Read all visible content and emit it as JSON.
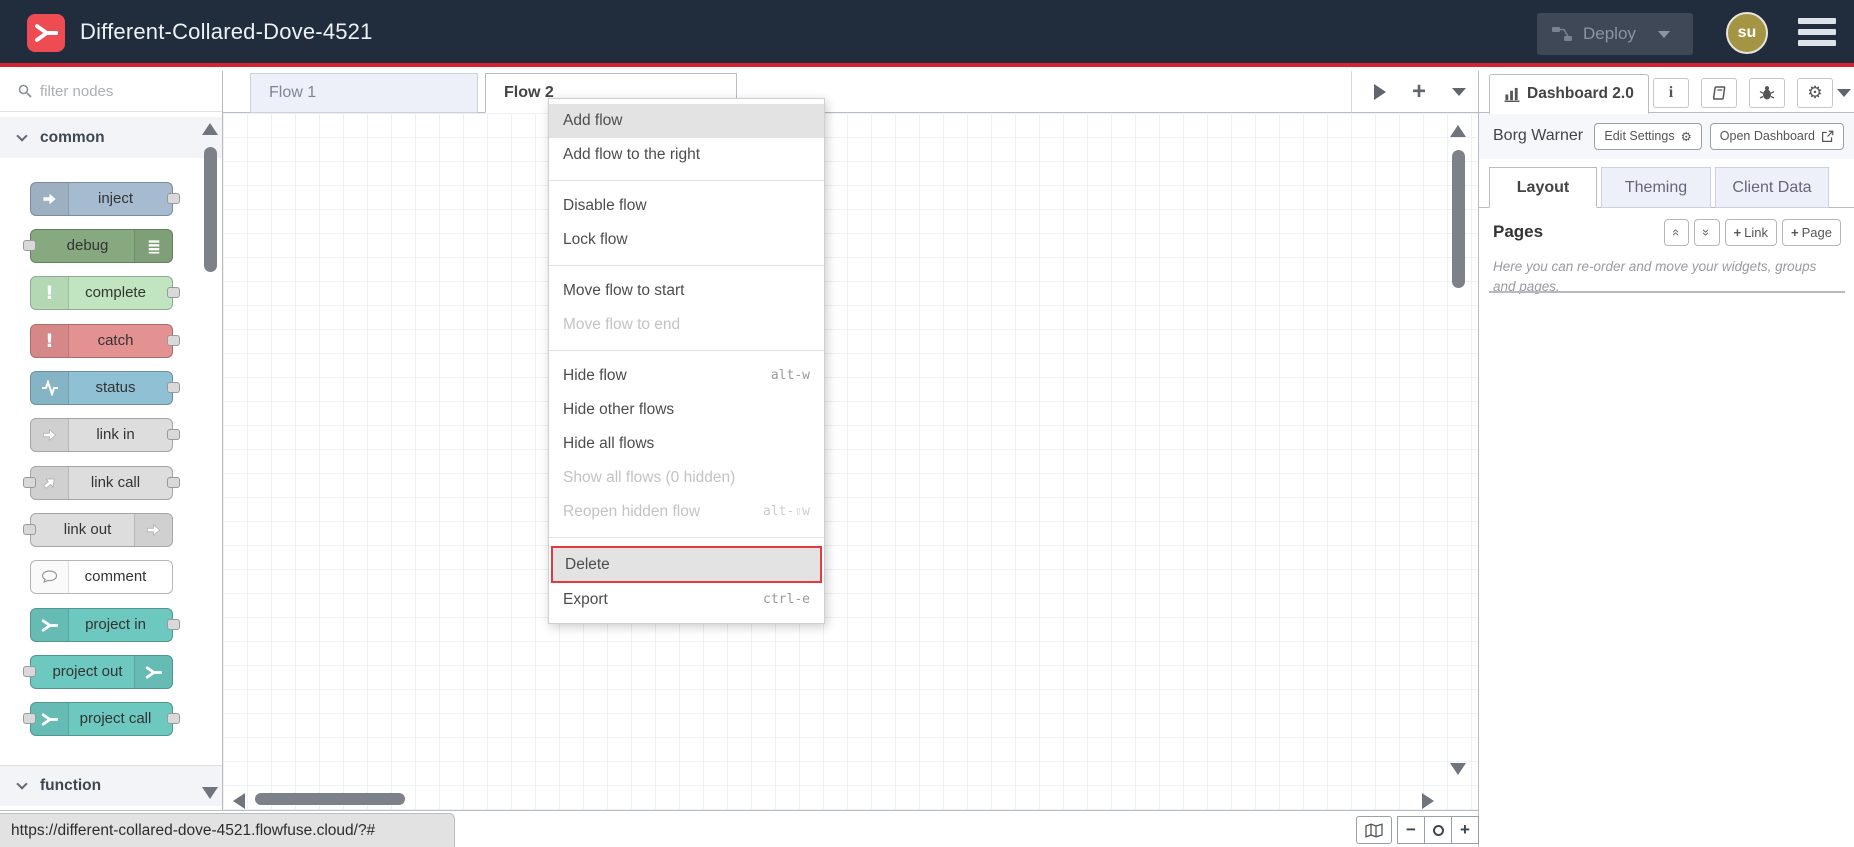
{
  "header": {
    "title": "Different-Collared-Dove-4521",
    "deploy_label": "Deploy",
    "avatar_initials": "su"
  },
  "palette": {
    "filter_placeholder": "filter nodes",
    "categories": [
      {
        "label": "common"
      },
      {
        "label": "function"
      }
    ],
    "nodes": [
      {
        "label": "inject",
        "color": "#a6bbcf",
        "icon": "arrow-right-icon"
      },
      {
        "label": "debug",
        "color": "#87a980",
        "icon": "list-icon"
      },
      {
        "label": "complete",
        "color": "#c0e5c0",
        "icon": "exclamation-icon"
      },
      {
        "label": "catch",
        "color": "#e49191",
        "icon": "exclamation-icon"
      },
      {
        "label": "status",
        "color": "#8fc0d4",
        "icon": "pulse-icon"
      },
      {
        "label": "link in",
        "color": "#dddddd",
        "icon": "link-arrow-icon"
      },
      {
        "label": "link call",
        "color": "#dddddd",
        "icon": "link-arrow-icon"
      },
      {
        "label": "link out",
        "color": "#dddddd",
        "icon": "link-arrow-icon"
      },
      {
        "label": "comment",
        "color": "#ffffff",
        "icon": "comment-bubble-icon"
      },
      {
        "label": "project in",
        "color": "#6dc8c0",
        "icon": "flowfuse-icon"
      },
      {
        "label": "project out",
        "color": "#6dc8c0",
        "icon": "flowfuse-icon"
      },
      {
        "label": "project call",
        "color": "#6dc8c0",
        "icon": "flowfuse-icon"
      }
    ]
  },
  "workspace": {
    "tabs": [
      {
        "label": "Flow 1"
      },
      {
        "label": "Flow 2"
      }
    ]
  },
  "context_menu": {
    "items": [
      {
        "label": "Add flow",
        "shortcut": ""
      },
      {
        "label": "Add flow to the right",
        "shortcut": ""
      },
      {
        "label": "Disable flow",
        "shortcut": ""
      },
      {
        "label": "Lock flow",
        "shortcut": ""
      },
      {
        "label": "Move flow to start",
        "shortcut": ""
      },
      {
        "label": "Move flow to end",
        "shortcut": ""
      },
      {
        "label": "Hide flow",
        "shortcut": "alt-w"
      },
      {
        "label": "Hide other flows",
        "shortcut": ""
      },
      {
        "label": "Hide all flows",
        "shortcut": ""
      },
      {
        "label": "Show all flows (0 hidden)",
        "shortcut": ""
      },
      {
        "label": "Reopen hidden flow",
        "shortcut": "alt-⇧w"
      },
      {
        "label": "Delete",
        "shortcut": ""
      },
      {
        "label": "Export",
        "shortcut": "ctrl-e"
      }
    ]
  },
  "sidebar": {
    "panel_tab": "Dashboard 2.0",
    "project_name": "Borg Warner",
    "edit_settings_label": "Edit Settings",
    "open_dashboard_label": "Open Dashboard",
    "tabs": [
      {
        "label": "Layout"
      },
      {
        "label": "Theming"
      },
      {
        "label": "Client Data"
      }
    ],
    "pages_title": "Pages",
    "link_button_label": "Link",
    "page_button_label": "Page",
    "help_text": "Here you can re-order and move your widgets, groups and pages."
  },
  "statusbar": {
    "url": "https://different-collared-dove-4521.flowfuse.cloud/?#"
  },
  "colors": {
    "header_bg": "#212c3c",
    "accent_red": "#d8212f",
    "logo_red": "#ee4b52",
    "avatar_bg": "#a39544",
    "deploy_bg": "#3e4856",
    "danger_border": "#e5393e",
    "inactive_tab_bg": "#edeff9",
    "grid_line": "#eef0f8",
    "flowfuse_teal": "#6dc8c0"
  },
  "icons": {
    "search-icon": "magnifier",
    "chevron-down-icon": "v",
    "hamburger-icon": "≡",
    "deploy-icon": "nodes-wire",
    "arrow-right-icon": "➔",
    "list-icon": "≣",
    "exclamation-icon": "!",
    "pulse-icon": "heartbeat",
    "comment-bubble-icon": "speech-bubble",
    "flowfuse-icon": "branch",
    "bar-chart-icon": "bars",
    "info-icon": "i",
    "book-icon": "book",
    "bug-icon": "bug",
    "gear-icon": "⚙",
    "external-link-icon": "box-arrow",
    "map-icon": "folded-map",
    "zoom-out-icon": "−",
    "zoom-reset-icon": "○",
    "zoom-in-icon": "+",
    "play-icon": "▶",
    "plus-icon": "+"
  }
}
